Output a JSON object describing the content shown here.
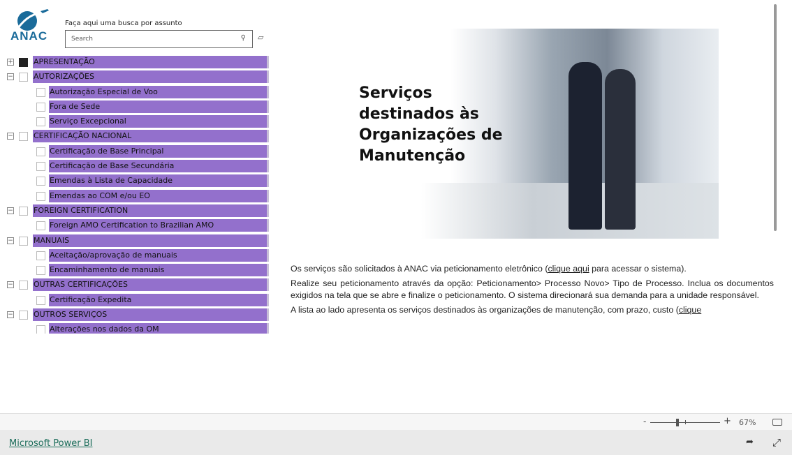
{
  "logo": {
    "text": "ANAC"
  },
  "search": {
    "label": "Faça aqui uma busca por assunto",
    "placeholder": "Search"
  },
  "tree": [
    {
      "level": 0,
      "label": "APRESENTAÇÃO",
      "expander": "+",
      "checked": true
    },
    {
      "level": 0,
      "label": "AUTORIZAÇÕES",
      "expander": "−",
      "checked": false
    },
    {
      "level": 1,
      "label": "Autorização Especial de Voo"
    },
    {
      "level": 1,
      "label": "Fora de Sede"
    },
    {
      "level": 1,
      "label": "Serviço Excepcional"
    },
    {
      "level": 0,
      "label": "CERTIFICAÇÃO NACIONAL",
      "expander": "−",
      "checked": false
    },
    {
      "level": 1,
      "label": "Certificação de Base Principal"
    },
    {
      "level": 1,
      "label": "Certificação de Base Secundária"
    },
    {
      "level": 1,
      "label": "Emendas à Lista de Capacidade"
    },
    {
      "level": 1,
      "label": "Emendas ao COM e/ou EO"
    },
    {
      "level": 0,
      "label": "FOREIGN CERTIFICATION",
      "expander": "−",
      "checked": false
    },
    {
      "level": 1,
      "label": "Foreign AMO Certification to Brazilian AMO"
    },
    {
      "level": 0,
      "label": "MANUAIS",
      "expander": "−",
      "checked": false
    },
    {
      "level": 1,
      "label": "Aceitação/aprovação de manuais"
    },
    {
      "level": 1,
      "label": "Encaminhamento de manuais"
    },
    {
      "level": 0,
      "label": "OUTRAS CERTIFICAÇÕES",
      "expander": "−",
      "checked": false
    },
    {
      "level": 1,
      "label": "Certificação Expedita"
    },
    {
      "level": 0,
      "label": "OUTROS SERVIÇOS",
      "expander": "−",
      "checked": false
    },
    {
      "level": 1,
      "label": "Alterações nos dados da OM"
    }
  ],
  "hero": {
    "title": "Serviços destinados às Organizações de Manutenção"
  },
  "body": {
    "p1_before": "Os serviços são solicitados à ANAC via peticionamento eletrônico (",
    "p1_link": "clique aqui",
    "p1_after": " para acessar o sistema).",
    "p2": "Realize seu peticionamento através da opção: Peticionamento> Processo Novo> Tipo de Processo. Inclua os documentos exigidos na tela que se abre e finalize o peticionamento. O sistema direcionará sua demanda para a unidade responsável.",
    "p3_before": "A lista ao lado apresenta os serviços destinados às organizações de manutenção, com prazo, custo (",
    "p3_link": "clique"
  },
  "zoom": {
    "minus": "-",
    "plus": "+",
    "percent": "67%",
    "level": 67
  },
  "footer": {
    "brand": "Microsoft Power BI"
  }
}
